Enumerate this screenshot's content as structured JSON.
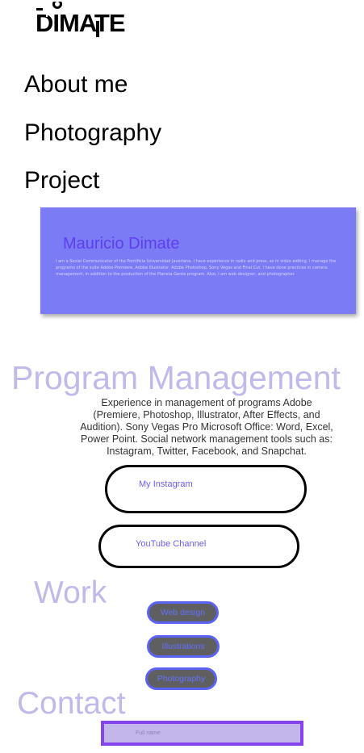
{
  "brand": {
    "logo_text": "DIMATE"
  },
  "nav": {
    "items": [
      {
        "label": "About me"
      },
      {
        "label": "Photography"
      },
      {
        "label": "Project"
      }
    ]
  },
  "about": {
    "name": "Mauricio Dimate",
    "bio": "I am a Social Communicator of the Pontificia Universidad Javeriana. I have experience in radio and press, as in video editing. I manage the programs of the suite Adobe Premiere, Adobe Illustrator, Adobe Photoshop, Sony Vegas and Final Cut. I have done practices in camera management, in addition to the production of the Planeta Gente program. Also, I am web designer, and photographer."
  },
  "program": {
    "title": "Program Management",
    "text": "Experience in management of programs Adobe (Premiere, Photoshop, Illustrator, After Effects, and Audition). Sony Vegas Pro Microsoft Office: Word, Excel, Power Point. Social network management tools such as: Instagram, Twitter, Facebook, and Snapchat."
  },
  "links": {
    "instagram": "My Instagram",
    "youtube": "YouTube Channel"
  },
  "work": {
    "title": "Work",
    "buttons": [
      {
        "label": "Web design"
      },
      {
        "label": "Illustrations"
      },
      {
        "label": "Photography"
      }
    ]
  },
  "contact": {
    "title": "Contact",
    "full_name_placeholder": "Full name"
  },
  "colors": {
    "accent": "#7b7bf6",
    "heading": "#c1b9ea",
    "input_border": "#8543ed"
  }
}
